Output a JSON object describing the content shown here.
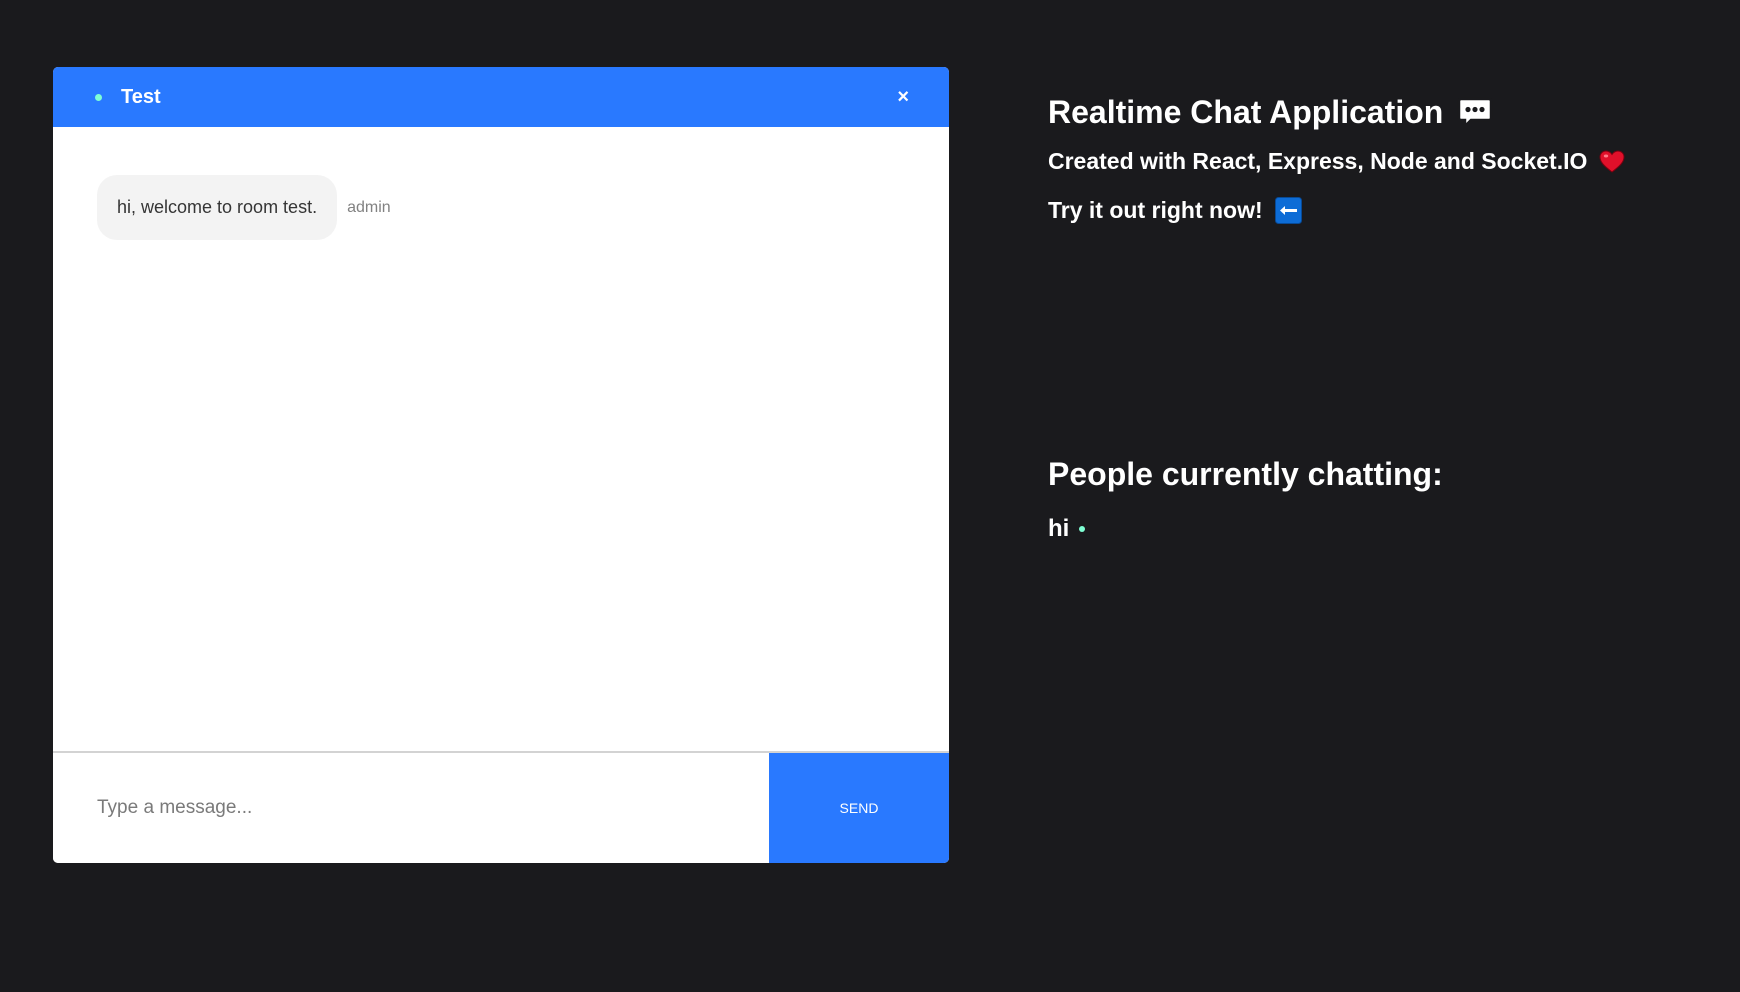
{
  "chat": {
    "room_name": "Test",
    "close_label": "×",
    "messages": [
      {
        "text": "hi, welcome to room test.",
        "sender": "admin"
      }
    ],
    "input": {
      "placeholder": "Type a message...",
      "value": ""
    },
    "send_label": "SEND"
  },
  "info": {
    "title": "Realtime Chat Application",
    "title_icon": "speech-bubble-icon",
    "line1": "Created with React, Express, Node and Socket.IO",
    "line1_icon": "heart-icon",
    "line2": "Try it out right now!",
    "line2_icon": "left-arrow-icon"
  },
  "people": {
    "title": "People currently chatting:",
    "users": [
      {
        "name": "hi",
        "status": "online"
      }
    ]
  },
  "colors": {
    "background": "#1a1a1d",
    "accent": "#2979ff",
    "online": "#7fffd4",
    "bubble": "#f3f3f3",
    "heart": "#e0102a",
    "arrow_box": "#0d6cd6"
  }
}
